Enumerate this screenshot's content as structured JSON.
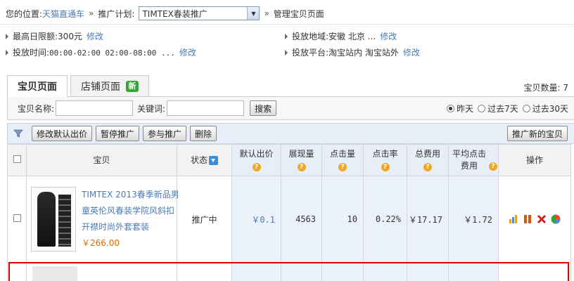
{
  "breadcrumb": {
    "prefix": "您的位置:",
    "root": "天猫直通车",
    "sep1": "»",
    "plan_label": "推广计划:",
    "plan_value": "TIMTEX春装推广",
    "sep2": "»",
    "current": "管理宝贝页面"
  },
  "info": {
    "daily_limit_label": "最高日限额:",
    "daily_limit_value": "300元",
    "time_label": "投放时间:",
    "time_value": "00:00-02:00 02:00-08:00 ...",
    "region_label": "投放地域:",
    "region_value": "安徽 北京 ...",
    "platform_label": "投放平台:",
    "platform_value": "淘宝站内 淘宝站外",
    "edit": "修改"
  },
  "tabs": [
    {
      "label": "宝贝页面",
      "active": true
    },
    {
      "label": "店铺页面",
      "active": false,
      "badge": "新"
    }
  ],
  "item_count": "宝贝数量: 7",
  "search": {
    "name_label": "宝贝名称:",
    "name_value": "",
    "keyword_label": "关键词:",
    "keyword_value": "",
    "button": "搜索",
    "ranges": [
      {
        "label": "昨天",
        "selected": true
      },
      {
        "label": "过去7天",
        "selected": false
      },
      {
        "label": "过去30天",
        "selected": false
      }
    ]
  },
  "toolbar": {
    "filter_icon": "filter-icon",
    "buttons": [
      "修改默认出价",
      "暂停推广",
      "参与推广",
      "删除"
    ],
    "promote_new": "推广新的宝贝"
  },
  "table": {
    "headers": {
      "item": "宝贝",
      "status": "状态",
      "default_bid": "默认出价",
      "impressions": "展现量",
      "clicks": "点击量",
      "ctr": "点击率",
      "total_cost": "总费用",
      "avg_cpc": "平均点击费用",
      "actions": "操作"
    },
    "rows": [
      {
        "title": "TIMTEX 2013春季新品男童英伦风春装学院风斜扣开襟时尚外套套装",
        "price": "￥266.00",
        "status": "推广中",
        "default_bid": "￥0.1",
        "impressions": "4563",
        "clicks": "10",
        "ctr": "0.22%",
        "total_cost": "￥17.17",
        "avg_cpc": "￥1.72",
        "actions": [
          "promote-icon",
          "pause-icon",
          "delete-icon",
          "report-icon"
        ]
      }
    ]
  },
  "colors": {
    "link": "#4a7bb7",
    "price": "#e06a00",
    "highlight_border": "#e00000",
    "data_column_bg": "#eaf1fa"
  }
}
